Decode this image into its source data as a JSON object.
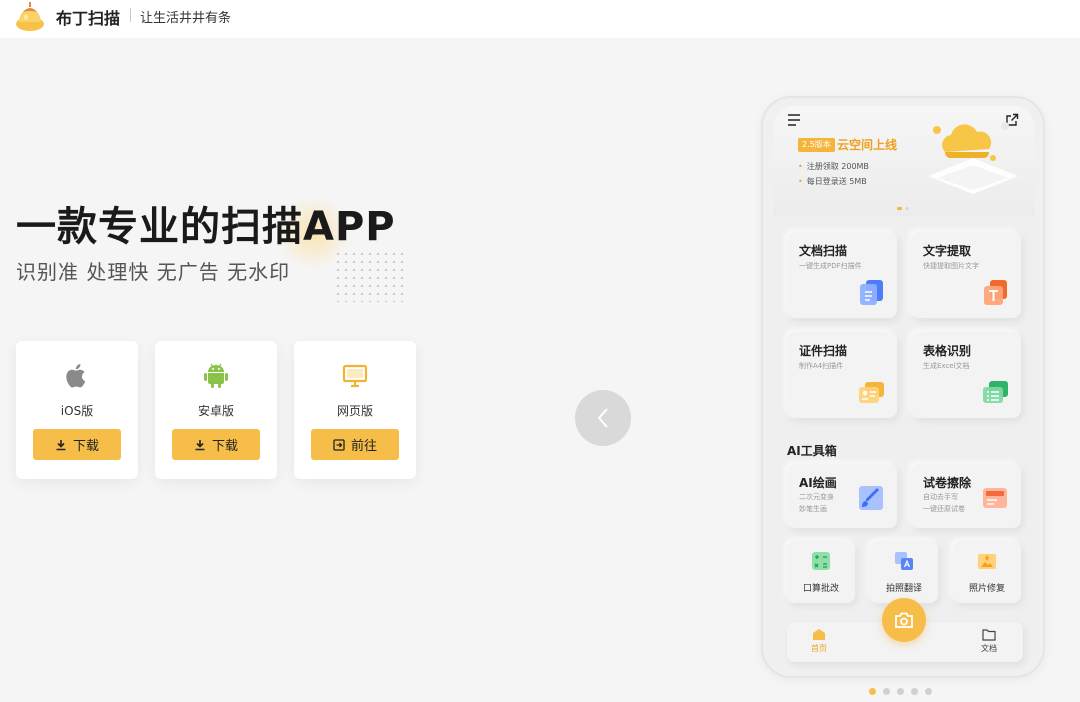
{
  "header": {
    "brand": "布丁扫描",
    "slogan": "让生活井井有条"
  },
  "hero": {
    "title": "一款专业的扫描APP",
    "subtitle": "识别准 处理快 无广告 无水印"
  },
  "downloads": [
    {
      "platform": "iOS版",
      "button": "下载",
      "icon": "apple-icon",
      "button_icon": "download-icon"
    },
    {
      "platform": "安卓版",
      "button": "下载",
      "icon": "android-icon",
      "button_icon": "download-icon"
    },
    {
      "platform": "网页版",
      "button": "前往",
      "icon": "monitor-icon",
      "button_icon": "enter-icon"
    }
  ],
  "phone": {
    "banner": {
      "version_badge": "2.5版本",
      "title": "云空间上线",
      "bullets": [
        "注册领取 200MB",
        "每日登录送 5MB"
      ]
    },
    "features": [
      {
        "title": "文档扫描",
        "desc": "一键生成PDF扫描件"
      },
      {
        "title": "文字提取",
        "desc": "快捷提取图片文字"
      },
      {
        "title": "证件扫描",
        "desc": "制作A4扫描件"
      },
      {
        "title": "表格识别",
        "desc": "生成Excel文档"
      }
    ],
    "ai_section_title": "AI工具箱",
    "ai_tools": [
      {
        "title": "AI绘画",
        "desc_line1": "二次元变身",
        "desc_line2": "妙笔生画"
      },
      {
        "title": "试卷擦除",
        "desc_line1": "自动去手写",
        "desc_line2": "一键还原试卷"
      }
    ],
    "small_tools": [
      "口算批改",
      "拍照翻译",
      "照片修复"
    ],
    "tabbar": {
      "home": "首页",
      "docs": "文档"
    }
  },
  "colors": {
    "accent": "#f6bd48",
    "accent_dark": "#f0a020",
    "background": "#f5f5f5"
  },
  "carousel": {
    "pages": 5,
    "active_index": 0
  }
}
